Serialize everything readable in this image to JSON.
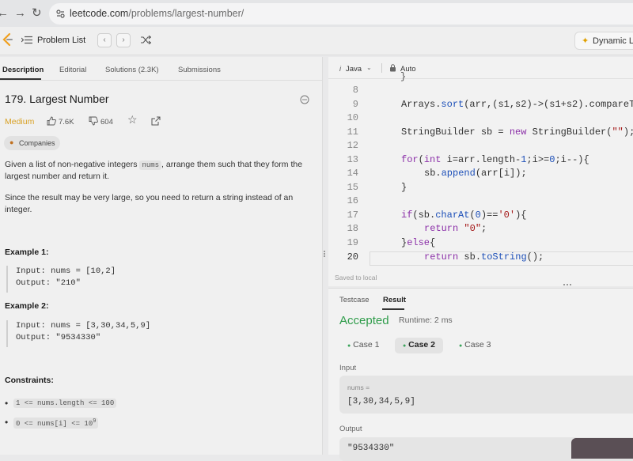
{
  "browser": {
    "url_domain": "leetcode.com",
    "url_path": "/problems/largest-number/"
  },
  "header": {
    "problem_list": "Problem List",
    "dynamic_label": "Dynamic L"
  },
  "left_tabs": [
    "Description",
    "Editorial",
    "Solutions (2.3K)",
    "Submissions"
  ],
  "problem": {
    "title": "179. Largest Number",
    "difficulty": "Medium",
    "likes": "7.6K",
    "dislikes": "604",
    "companies": "Companies",
    "desc1_a": "Given a list of non-negative integers ",
    "desc1_code": "nums",
    "desc1_b": ", arrange them such that they form the",
    "desc1_c": "largest number and return it.",
    "desc2_a": "Since the result may be very large, so you need to return a string instead of an",
    "desc2_b": "integer.",
    "example1_title": "Example 1:",
    "example1_input": "Input: nums = [10,2]",
    "example1_output": "Output: \"210\"",
    "example2_title": "Example 2:",
    "example2_input": "Input: nums = [3,30,34,5,9]",
    "example2_output": "Output: \"9534330\"",
    "constraints_title": "Constraints:",
    "constraint1": "1 <= nums.length <= 100",
    "constraint2": "0 <= nums[i] <= 10",
    "constraint2_sup": "9"
  },
  "editor": {
    "language": "Java",
    "mode": "Auto",
    "saved_status": "Saved to local",
    "line_numbers": [
      "8",
      "9",
      "10",
      "11",
      "12",
      "13",
      "14",
      "15",
      "16",
      "17",
      "18",
      "19",
      "20"
    ],
    "code": {
      "l9_a": "Arrays.",
      "l9_b": "sort",
      "l9_c": "(arr,(s1,s2)->(s1+s2).compareTo",
      "l11_a": "StringBuilder sb = ",
      "l11_kw": "new",
      "l11_b": " StringBuilder(",
      "l11_str": "\"\"",
      "l11_c": ");",
      "l13_kw": "for",
      "l13_a": "(",
      "l13_kw2": "int",
      "l13_b": " i=arr.length-",
      "l13_n": "1",
      "l13_c": ";i>=",
      "l13_n2": "0",
      "l13_d": ";i--){",
      "l14_a": "sb.",
      "l14_b": "append",
      "l14_c": "(arr[i]);",
      "l15": "}",
      "l17_kw": "if",
      "l17_a": "(sb.",
      "l17_b": "charAt",
      "l17_c": "(",
      "l17_n": "0",
      "l17_d": ")==",
      "l17_str": "'0'",
      "l17_e": "){",
      "l18_kw": "return",
      "l18_str": "\"0\"",
      "l18_a": ";",
      "l19_a": "}",
      "l19_kw": "else",
      "l19_b": "{",
      "l20_kw": "return",
      "l20_a": " sb.",
      "l20_b": "toString",
      "l20_c": "();"
    }
  },
  "result": {
    "tabs": [
      "Testcase",
      "Result"
    ],
    "status": "Accepted",
    "runtime": "Runtime: 2 ms",
    "cases": [
      "Case 1",
      "Case 2",
      "Case 3"
    ],
    "input_label": "Input",
    "input_var": "nums =",
    "input_value": "[3,30,34,5,9]",
    "output_label": "Output",
    "output_value": "\"9534330\""
  },
  "colors": {
    "medium": "#d9a227",
    "accepted": "#2e9c4a",
    "case_dot": "#3aa35a"
  }
}
